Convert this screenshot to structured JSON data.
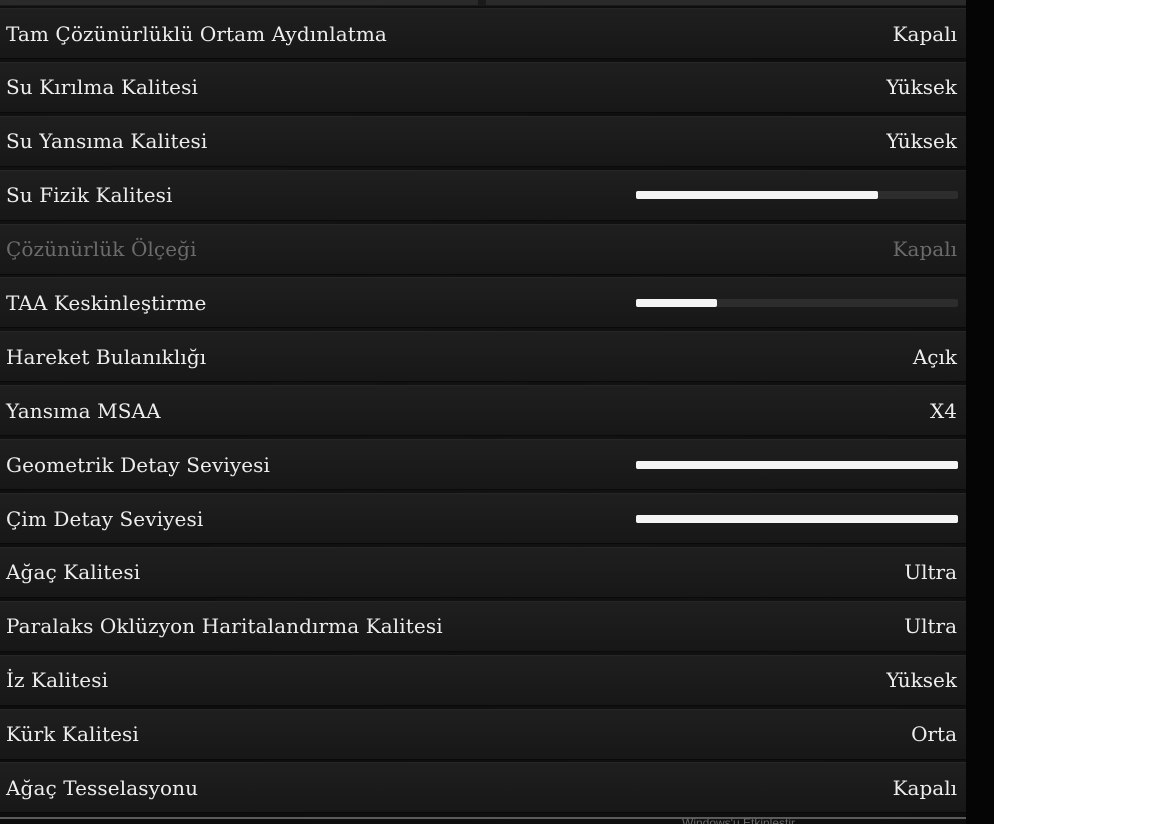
{
  "settings": [
    {
      "label": "Tam Çözünürlüklü Ortam Aydınlatma",
      "value": "Kapalı"
    },
    {
      "label": "Su Kırılma Kalitesi",
      "value": "Yüksek"
    },
    {
      "label": "Su Yansıma Kalitesi",
      "value": "Yüksek"
    },
    {
      "label": "Su Fizik Kalitesi",
      "slider_percent": 75
    },
    {
      "label": "Çözünürlük Ölçeği",
      "value": "Kapalı",
      "disabled": true
    },
    {
      "label": "TAA Keskinleştirme",
      "slider_percent": 25
    },
    {
      "label": "Hareket Bulanıklığı",
      "value": "Açık"
    },
    {
      "label": "Yansıma MSAA",
      "value": "X4"
    },
    {
      "label": "Geometrik Detay Seviyesi",
      "slider_percent": 100
    },
    {
      "label": "Çim Detay Seviyesi",
      "slider_percent": 100
    },
    {
      "label": "Ağaç Kalitesi",
      "value": "Ultra"
    },
    {
      "label": "Paralaks Oklüzyon Haritalandırma Kalitesi",
      "value": "Ultra"
    },
    {
      "label": "İz Kalitesi",
      "value": "Yüksek"
    },
    {
      "label": "Kürk Kalitesi",
      "value": "Orta"
    },
    {
      "label": "Ağaç Tesselasyonu",
      "value": "Kapalı"
    }
  ],
  "footer": {
    "text": "Windows'u Etkinleştir"
  },
  "colors": {
    "text": "#ededed",
    "text_disabled": "#6b6b6b",
    "row_bg": "#1c1c1c",
    "slider_fill": "#f4f4f4",
    "slider_track": "#2d2d2d"
  }
}
